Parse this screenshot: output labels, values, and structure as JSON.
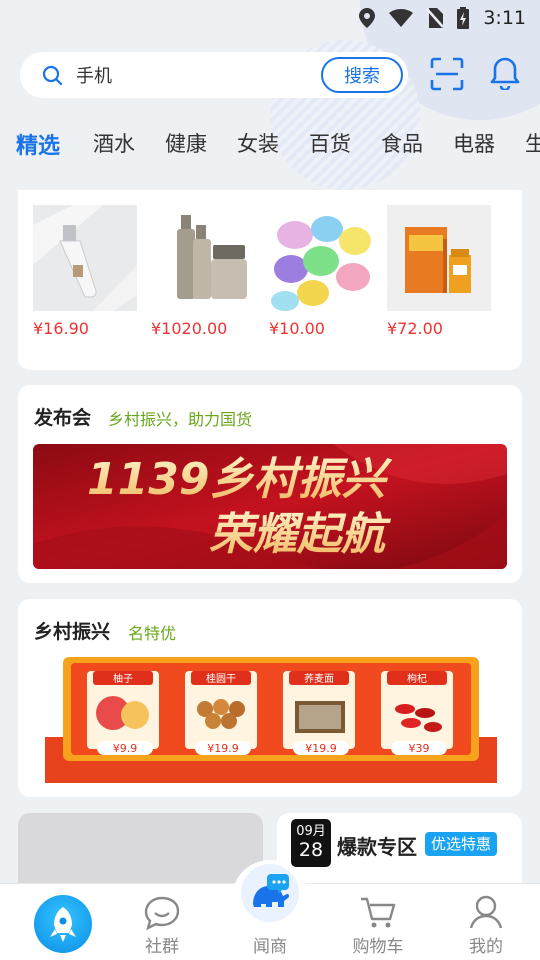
{
  "status_bar": {
    "time": "3:11"
  },
  "search": {
    "value": "手机",
    "button_label": "搜索"
  },
  "tabs": [
    {
      "label": "精选",
      "active": true
    },
    {
      "label": "酒水"
    },
    {
      "label": "健康"
    },
    {
      "label": "女装"
    },
    {
      "label": "百货"
    },
    {
      "label": "食品"
    },
    {
      "label": "电器"
    },
    {
      "label": "生"
    }
  ],
  "products": [
    {
      "price": "¥16.90",
      "icon": "perfume-bottle"
    },
    {
      "price": "¥1020.00",
      "icon": "cosmetics-set"
    },
    {
      "price": "¥10.00",
      "icon": "laundry-pods"
    },
    {
      "price": "¥72.00",
      "icon": "health-box"
    }
  ],
  "launch": {
    "title": "发布会",
    "subtitle": "乡村振兴，助力国货",
    "banner_line1": "1139乡村振兴",
    "banner_line2": "荣耀起航"
  },
  "rural": {
    "title": "乡村振兴",
    "subtitle": "名特优",
    "items": [
      {
        "name": "柚子",
        "price": "¥9.9"
      },
      {
        "name": "桂圆干",
        "price": "¥19.9"
      },
      {
        "name": "荞麦面",
        "price": "¥19.9"
      },
      {
        "name": "枸杞",
        "price": "¥39"
      }
    ]
  },
  "hot": {
    "cal_month": "09月",
    "cal_day": "28",
    "title": "爆款专区",
    "badge": "优选特惠"
  },
  "nav": [
    {
      "label": ""
    },
    {
      "label": "社群"
    },
    {
      "label": "闻商"
    },
    {
      "label": "购物车"
    },
    {
      "label": "我的"
    }
  ],
  "colors": {
    "accent": "#1a73e8",
    "price": "#ee3333",
    "subtitle_green": "#6aa61c",
    "badge_blue": "#1aa3f0"
  }
}
